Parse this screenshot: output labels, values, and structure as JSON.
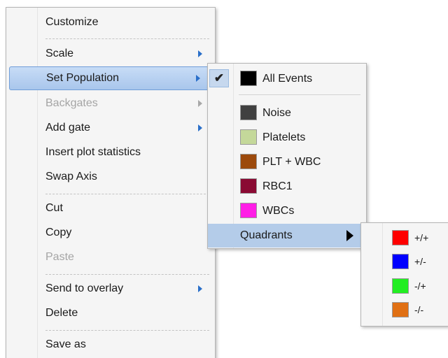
{
  "main_menu": {
    "items": [
      {
        "label": "Customize"
      },
      {
        "label": "Scale"
      },
      {
        "label": "Set Population"
      },
      {
        "label": "Backgates"
      },
      {
        "label": "Add gate"
      },
      {
        "label": "Insert plot statistics"
      },
      {
        "label": "Swap Axis"
      },
      {
        "label": "Cut"
      },
      {
        "label": "Copy"
      },
      {
        "label": "Paste"
      },
      {
        "label": "Send to overlay"
      },
      {
        "label": "Delete"
      },
      {
        "label": "Save as"
      }
    ]
  },
  "population_menu": {
    "checkmark": "✔",
    "selected": "All Events",
    "items": [
      {
        "label": "All Events",
        "color": "#000000"
      },
      {
        "label": "Noise",
        "color": "#404040"
      },
      {
        "label": "Platelets",
        "color": "#c4d89a"
      },
      {
        "label": "PLT + WBC",
        "color": "#9c4a0c"
      },
      {
        "label": "RBC1",
        "color": "#8a0a33"
      },
      {
        "label": "WBCs",
        "color": "#ff1ee6"
      },
      {
        "label": "Quadrants"
      }
    ]
  },
  "quadrants_menu": {
    "items": [
      {
        "label": "+/+",
        "color": "#ff0000"
      },
      {
        "label": "+/-",
        "color": "#0000ff"
      },
      {
        "label": "-/+",
        "color": "#22ee22"
      },
      {
        "label": "-/-",
        "color": "#e07014"
      }
    ]
  }
}
